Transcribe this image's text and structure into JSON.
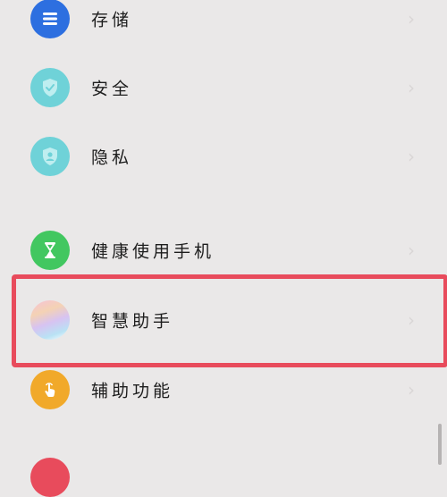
{
  "colors": {
    "storage": "#2d6fe0",
    "security": "#6fd2d8",
    "privacy": "#6fd2d8",
    "digital_wellbeing": "#42c760",
    "smart_assistant": "#f3b9d6",
    "accessibility": "#f1a92a",
    "highlight": "#e84b5c"
  },
  "items": [
    {
      "label": "存储",
      "icon": "storage-icon"
    },
    {
      "label": "安全",
      "icon": "shield-check-icon"
    },
    {
      "label": "隐私",
      "icon": "privacy-shield-icon"
    },
    {
      "label": "健康使用手机",
      "icon": "hourglass-icon"
    },
    {
      "label": "智慧助手",
      "icon": "smart-assistant-icon"
    },
    {
      "label": "辅助功能",
      "icon": "accessibility-hand-icon"
    }
  ]
}
